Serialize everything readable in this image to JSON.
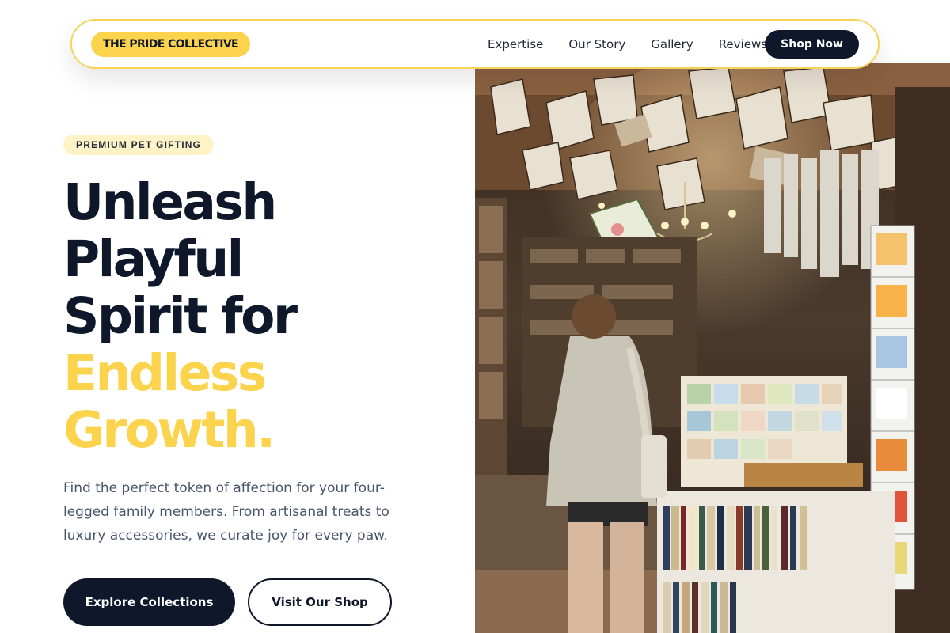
{
  "nav": {
    "brand": "THE PRIDE COLLECTIVE",
    "links": [
      "Expertise",
      "Our Story",
      "Gallery",
      "Reviews"
    ],
    "cta": "Shop Now"
  },
  "hero": {
    "badge": "PREMIUM PET GIFTING",
    "headline_lines": [
      "Unleash",
      "Playful",
      "Spirit for"
    ],
    "headline_accent_lines": [
      "Endless",
      "Growth."
    ],
    "description": "Find the perfect token of affection for your four-legged family members. From artisanal treats to luxury accessories, we curate joy for every paw.",
    "primary_button": "Explore Collections",
    "secondary_button": "Visit Our Shop"
  },
  "colors": {
    "accent": "#fcd34d",
    "dark": "#0f172a",
    "muted_text": "#475569",
    "badge_bg": "#fef3c7"
  }
}
